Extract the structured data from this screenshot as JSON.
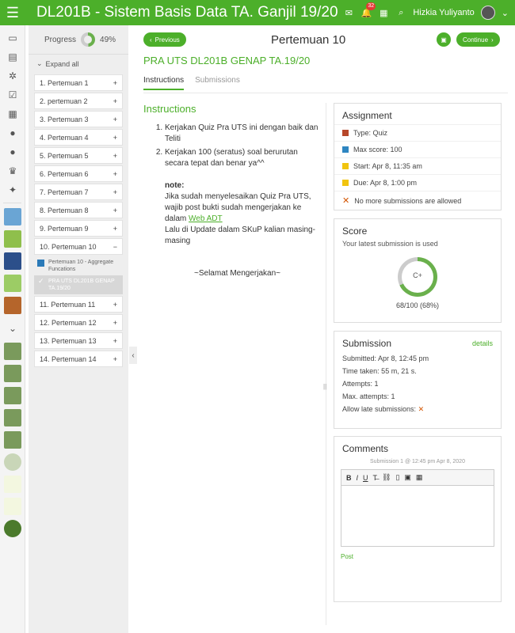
{
  "app": {
    "title": "DL201B - Sistem Basis Data TA. Ganjil 19/20",
    "notif_count": "32",
    "user_name": "Hizkia Yuliyanto"
  },
  "sidebar": {
    "progress_label": "Progress",
    "progress_percent": "49%",
    "progress_value": 0.49,
    "expand_label": "Expand all",
    "weeks": [
      {
        "label": "1. Pertemuan 1",
        "sign": "+"
      },
      {
        "label": "2. pertemuan 2",
        "sign": "+"
      },
      {
        "label": "3. Pertemuan 3",
        "sign": "+"
      },
      {
        "label": "4. Pertemuan 4",
        "sign": "+"
      },
      {
        "label": "5. Pertemuan 5",
        "sign": "+"
      },
      {
        "label": "6. Pertemuan 6",
        "sign": "+"
      },
      {
        "label": "7. Pertemuan 7",
        "sign": "+"
      },
      {
        "label": "8. Pertemuan 8",
        "sign": "+"
      },
      {
        "label": "9. Pertemuan 9",
        "sign": "+"
      },
      {
        "label": "10. Pertemuan 10",
        "sign": "−"
      }
    ],
    "sub_items": [
      {
        "label": "Pertemuan 10 - Aggregate Funcations"
      },
      {
        "label": "PRA UTS DL201B GENAP TA.19/20"
      }
    ],
    "weeks_after": [
      {
        "label": "11. Pertemuan 11",
        "sign": "+"
      },
      {
        "label": "12. Pertemuan 12",
        "sign": "+"
      },
      {
        "label": "13. Pertemuan 13",
        "sign": "+"
      },
      {
        "label": "14. Pertemuan 14",
        "sign": "+"
      }
    ]
  },
  "nav": {
    "previous_label": "Previous",
    "continue_label": "Continue",
    "page_heading": "Pertemuan 10"
  },
  "course_title": "PRA UTS DL201B GENAP TA.19/20",
  "tabs": [
    {
      "label": "Instructions"
    },
    {
      "label": "Submissions"
    }
  ],
  "instructions": {
    "heading": "Instructions",
    "items": [
      "Kerjakan Quiz Pra UTS ini dengan baik dan Teliti",
      "Kerjakan 100 (seratus) soal berurutan secara tepat dan benar ya^^"
    ],
    "note_label": "note:",
    "note_text_before": "Jika sudah menyelesaikan Quiz Pra UTS, wajib post bukti sudah mengerjakan ke dalam ",
    "note_link": "Web ADT",
    "note_text_after": "Lalu di Update dalam SKuP kalian masing-masing",
    "closing": "~Selamat Mengerjakan~"
  },
  "assignment": {
    "title": "Assignment",
    "type": "Type: Quiz",
    "max_score": "Max score: 100",
    "start": "Start: Apr 8, 11:35 am",
    "due": "Due: Apr 8, 1:00 pm",
    "no_more": "No more submissions are allowed"
  },
  "score": {
    "title": "Score",
    "subtitle": "Your latest submission is used",
    "grade": "C+",
    "value": "68/100 (68%)",
    "fraction": 0.68
  },
  "submission": {
    "title": "Submission",
    "details_label": "details",
    "submitted": "Submitted: Apr 8, 12:45 pm",
    "time_taken": "Time taken: 55 m, 21 s.",
    "attempts": "Attempts: 1",
    "max_attempts": "Max. attempts: 1",
    "allow_late": "Allow late submissions:"
  },
  "comments": {
    "title": "Comments",
    "caption": "Submission 1 @ 12:45 pm Apr 8, 2020",
    "post_label": "Post"
  },
  "colors": {
    "brand_green": "#4caf2a",
    "accent_orange": "#d35400"
  }
}
